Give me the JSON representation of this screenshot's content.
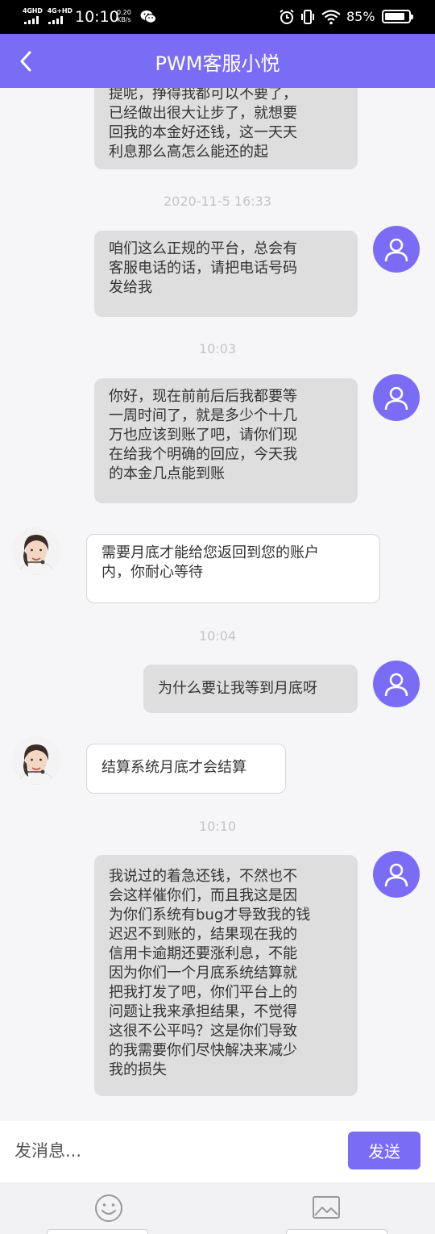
{
  "status_bar": {
    "network_1": "4GHD",
    "network_2": "4G+HD",
    "time": "10:10",
    "speed_value": "0.20",
    "speed_unit": "KB/s",
    "battery_text": "85%",
    "battery_level": 0.85,
    "icons": [
      "signal-icon",
      "wechat-icon",
      "alarm-icon",
      "vibrate-icon",
      "wifi-icon",
      "battery-icon"
    ]
  },
  "header": {
    "title": "PWM客服小悦",
    "back_icon": "chevron-left-icon",
    "color": "#7b6cf6"
  },
  "messages": [
    {
      "type": "user",
      "text": "提呢，挣得我都可以不要了，\n已经做出很大让步了，就想要\n回我的本金好还钱，这一天天\n利息那么高怎么能还的起"
    },
    {
      "type": "timestamp",
      "text": "2020-11-5 16:33"
    },
    {
      "type": "user",
      "text": "咱们这么正规的平台，总会有\n客服电话的话，请把电话号码\n发给我"
    },
    {
      "type": "timestamp",
      "text": "10:03"
    },
    {
      "type": "user",
      "text": "你好，现在前前后后我都要等\n一周时间了，就是多少个十几\n万也应该到账了吧，请你们现\n在给我个明确的回应，今天我\n的本金几点能到账"
    },
    {
      "type": "agent",
      "text": "需要月底才能给您返回到您的账户\n内，你耐心等待"
    },
    {
      "type": "timestamp",
      "text": "10:04"
    },
    {
      "type": "user",
      "text": "为什么要让我等到月底呀"
    },
    {
      "type": "agent",
      "text": "结算系统月底才会结算"
    },
    {
      "type": "timestamp",
      "text": "10:10"
    },
    {
      "type": "user",
      "text": "我说过的着急还钱，不然也不\n会这样催你们，而且我这是因\n为你们系统有bug才导致我的钱\n迟迟不到账的，结果现在我的\n信用卡逾期还要涨利息，不能\n因为你们一个月底系统结算就\n把我打发了吧，你们平台上的\n问题让我来承担结果，不觉得\n这很不公平吗？这是你们导致\n的我需要你们尽快解决来减少\n我的损失"
    }
  ],
  "input": {
    "placeholder": "发消息...",
    "send_label": "发送"
  },
  "toolbar": {
    "items": [
      "emoji-icon",
      "image-icon"
    ]
  },
  "colors": {
    "accent": "#7b6cf6",
    "user_bubble": "#dedede",
    "agent_bubble": "#ffffff",
    "background": "#f6f6f8"
  }
}
